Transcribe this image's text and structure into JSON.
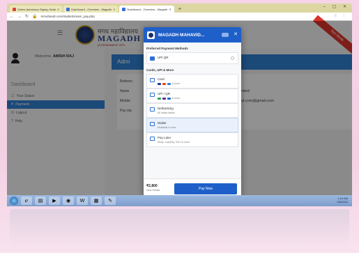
{
  "browser": {
    "tabs": [
      {
        "label": "Online Admission Signup Detai",
        "active": false
      },
      {
        "label": "Dashboard - Overview - Magadh",
        "active": false
      },
      {
        "label": "Dashboard - Overview - Magadh",
        "active": true
      }
    ],
    "url": "mmuhandi.com/students/user_pay.php"
  },
  "site": {
    "brand_hindi": "मगध महाविद्यालय",
    "brand_name": "MAGADH",
    "brand_tagline": "(A PERMANENT AFFI",
    "test_mode": "Test Mode"
  },
  "sidebar": {
    "welcome_prefix": "Welcome,",
    "welcome_user": "AMISH RAJ",
    "dashboard_label": "Dashboard",
    "items": [
      {
        "label": "Your Status",
        "icon": "status-icon",
        "active": false
      },
      {
        "label": "Payment",
        "icon": "payment-icon",
        "active": true
      },
      {
        "label": "Logout",
        "icon": "logout-icon",
        "active": false
      },
      {
        "label": "Help",
        "icon": "help-icon",
        "active": false
      }
    ]
  },
  "main": {
    "admin_title": "Admi",
    "rows": [
      {
        "label": "Referen",
        "value": ""
      },
      {
        "label": "Name",
        "value": "imited"
      },
      {
        "label": "Mobile",
        "value": "pal.com@gmail.com"
      },
      {
        "label": "Pay sta",
        "value": ""
      }
    ]
  },
  "checkout": {
    "merchant": "MAGADH MAHAVID...",
    "preferred_title": "Preferred Payment Methods",
    "preferred": [
      {
        "label": "UPI QR"
      }
    ],
    "all_title": "Cards, UPI & More",
    "methods": [
      {
        "label": "Card",
        "sub": "& more",
        "icon": "card-icon",
        "selected": false
      },
      {
        "label": "UPI / QR",
        "sub": "& more",
        "icon": "upi-icon",
        "selected": false
      },
      {
        "label": "Netbanking",
        "sub": "All Indian banks",
        "icon": "bank-icon",
        "selected": false
      },
      {
        "label": "Wallet",
        "sub": "Mobikwik & more",
        "icon": "wallet-icon",
        "selected": true
      },
      {
        "label": "Pay Later",
        "sub": "Simpl, LazyPay, ICICI & more",
        "icon": "paylater-icon",
        "selected": false
      }
    ],
    "amount": "₹2,800",
    "view_details": "View Details",
    "pay_label": "Pay Now"
  },
  "taskbar": {
    "time": "1:15 AM",
    "date": "2/8/2024"
  },
  "colors": {
    "accent": "#1f5fc9",
    "sidebar_active": "#2f7fcf",
    "test_ribbon": "#d9342b"
  }
}
